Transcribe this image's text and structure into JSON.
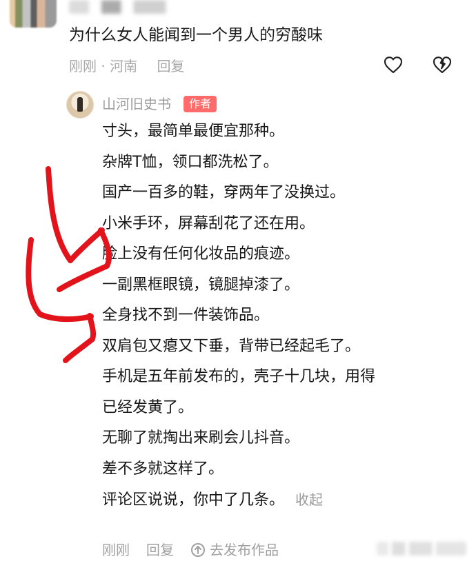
{
  "question": "为什么女人能闻到一个男人的穷酸味",
  "question_meta": {
    "time_location": "刚刚 · 河南",
    "reply_label": "回复"
  },
  "icons": {
    "like": "heart-outline-icon",
    "dislike": "broken-heart-icon",
    "publish": "arrow-up-circle-icon"
  },
  "reply": {
    "author_name": "山河旧史书",
    "author_badge": "作者",
    "lines": [
      "寸头，最简单最便宜那种。",
      "杂牌T恤，领口都洗松了。",
      "国产一百多的鞋，穿两年了没换过。",
      "小米手环，屏幕刮花了还在用。",
      "脸上没有任何化妆品的痕迹。",
      "一副黑框眼镜，镜腿掉漆了。",
      "全身找不到一件装饰品。",
      "双肩包又瘪又下垂，背带已经起毛了。",
      " 手机是五年前发布的，壳子十几块，用得",
      "已经发黄了。",
      "无聊了就掏出来刷会儿抖音。",
      "差不多就这样了。",
      "评论区说说，你中了几条。"
    ],
    "collapse_label": "收起",
    "footer": {
      "time": "刚刚",
      "reply": "回复",
      "publish": "去发布作品"
    }
  },
  "colors": {
    "badge": "#ff6a6a",
    "annotation": "#e3131b"
  }
}
